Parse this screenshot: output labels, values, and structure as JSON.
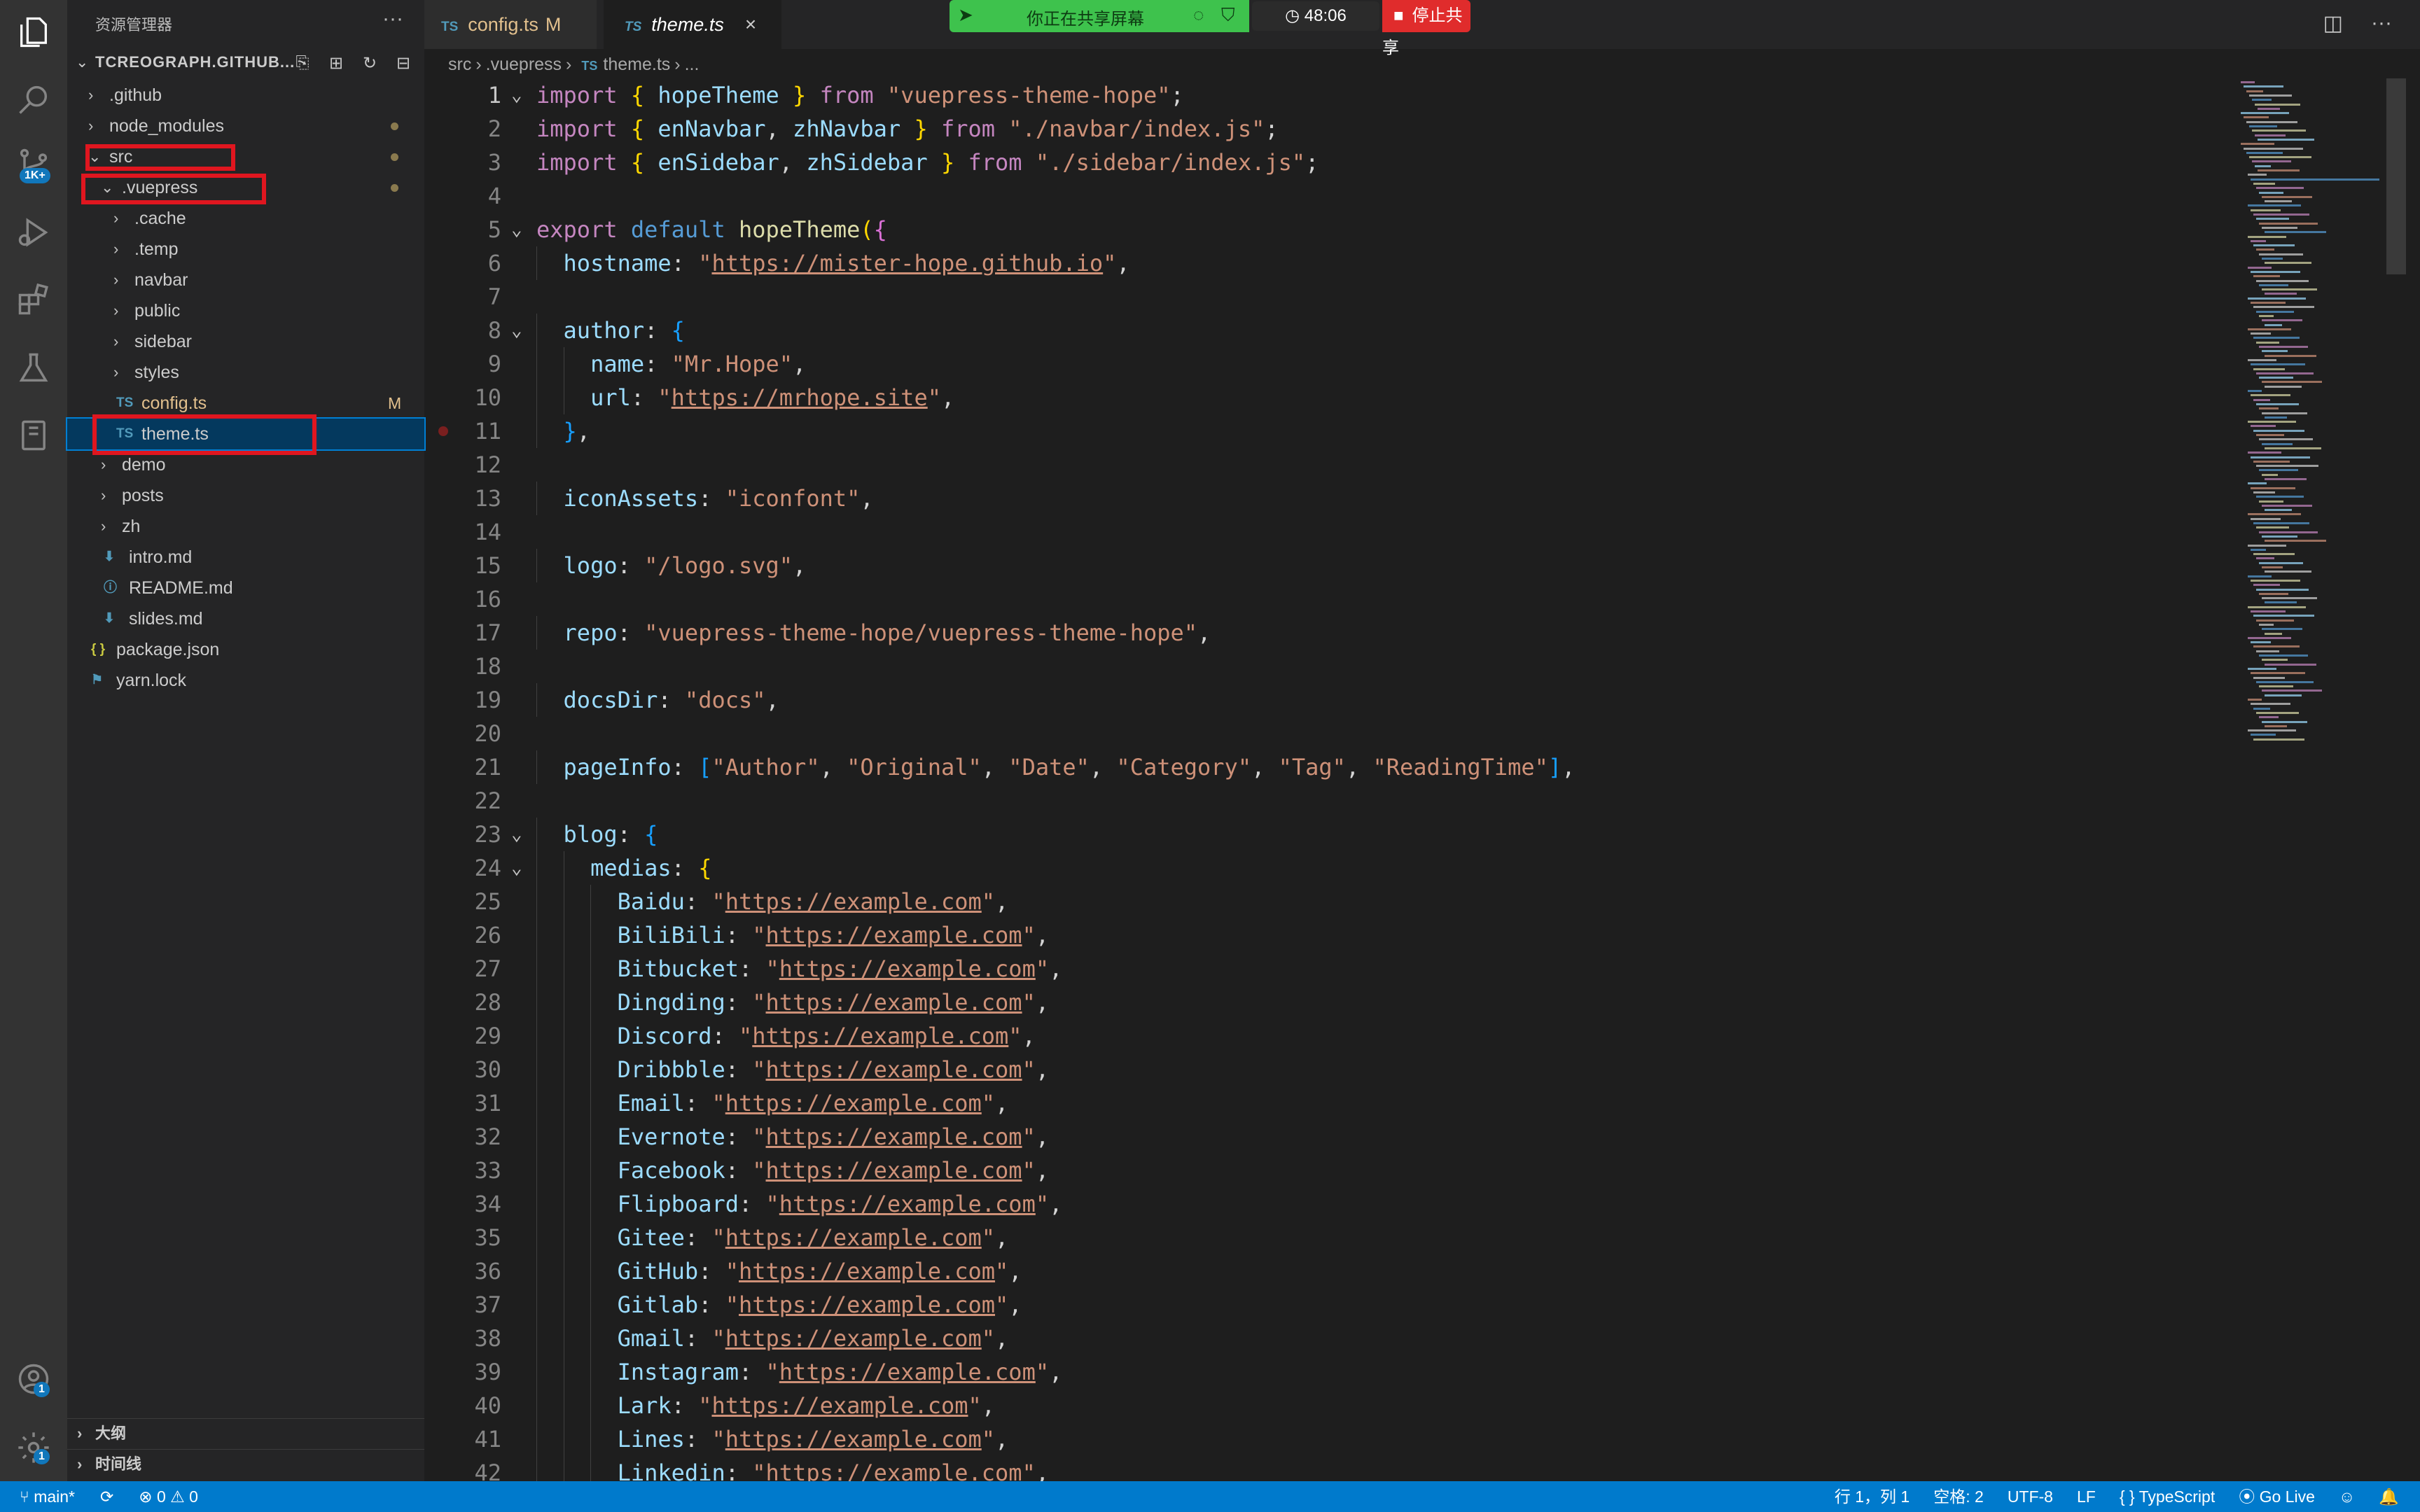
{
  "activity": {
    "scm_badge": "1K+",
    "accounts_badge": "1",
    "settings_badge": "1"
  },
  "explorer": {
    "title": "资源管理器",
    "more": "···",
    "workspace": "TCREOGRAPH.GITHUB...",
    "items": [
      {
        "label": ".github",
        "level": 0,
        "type": "folder",
        "open": false
      },
      {
        "label": "node_modules",
        "level": 0,
        "type": "folder",
        "open": false,
        "dot": true
      },
      {
        "label": "src",
        "level": 0,
        "type": "folder",
        "open": true,
        "dot": true
      },
      {
        "label": ".vuepress",
        "level": 1,
        "type": "folder",
        "open": true,
        "dot": true
      },
      {
        "label": ".cache",
        "level": 2,
        "type": "folder",
        "open": false
      },
      {
        "label": ".temp",
        "level": 2,
        "type": "folder",
        "open": false
      },
      {
        "label": "navbar",
        "level": 2,
        "type": "folder",
        "open": false
      },
      {
        "label": "public",
        "level": 2,
        "type": "folder",
        "open": false
      },
      {
        "label": "sidebar",
        "level": 2,
        "type": "folder",
        "open": false
      },
      {
        "label": "styles",
        "level": 2,
        "type": "folder",
        "open": false
      },
      {
        "label": "config.ts",
        "level": 2,
        "type": "ts",
        "modified": "M"
      },
      {
        "label": "theme.ts",
        "level": 2,
        "type": "ts",
        "selected": true
      },
      {
        "label": "demo",
        "level": 1,
        "type": "folder",
        "open": false
      },
      {
        "label": "posts",
        "level": 1,
        "type": "folder",
        "open": false
      },
      {
        "label": "zh",
        "level": 1,
        "type": "folder",
        "open": false
      },
      {
        "label": "intro.md",
        "level": 1,
        "type": "md"
      },
      {
        "label": "README.md",
        "level": 1,
        "type": "info"
      },
      {
        "label": "slides.md",
        "level": 1,
        "type": "md"
      },
      {
        "label": "package.json",
        "level": 0,
        "type": "json"
      },
      {
        "label": "yarn.lock",
        "level": 0,
        "type": "yarn"
      }
    ],
    "outline": "大纲",
    "timeline": "时间线"
  },
  "tabs": [
    {
      "label": "config.ts",
      "lang": "TS",
      "modified": "M"
    },
    {
      "label": "theme.ts",
      "lang": "TS",
      "close": "×"
    }
  ],
  "share": {
    "message": "你正在共享屏幕",
    "timer": "48:06",
    "stop": "停止共享"
  },
  "breadcrumb": {
    "parts": [
      "src",
      ".vuepress"
    ],
    "lang": "TS",
    "file": "theme.ts",
    "tail": "..."
  },
  "status": {
    "branch": "main*",
    "errors": "0",
    "warnings": "0",
    "position": "行 1，列 1",
    "spaces": "空格: 2",
    "encoding": "UTF-8",
    "eol": "LF",
    "language": "TypeScript",
    "golive": "Go Live"
  },
  "code": {
    "lines": [
      [
        [
          "kw",
          "import"
        ],
        [
          "pn",
          " "
        ],
        [
          "p1",
          "{"
        ],
        [
          "var",
          " hopeTheme "
        ],
        [
          "p1",
          "}"
        ],
        [
          "kw",
          " from "
        ],
        [
          "str",
          "\"vuepress-theme-hope\""
        ],
        [
          "pn",
          ";"
        ]
      ],
      [
        [
          "kw",
          "import"
        ],
        [
          "pn",
          " "
        ],
        [
          "p1",
          "{"
        ],
        [
          "var",
          " enNavbar"
        ],
        [
          "pn",
          ","
        ],
        [
          "var",
          " zhNavbar "
        ],
        [
          "p1",
          "}"
        ],
        [
          "kw",
          " from "
        ],
        [
          "str",
          "\"./navbar/index.js\""
        ],
        [
          "pn",
          ";"
        ]
      ],
      [
        [
          "kw",
          "import"
        ],
        [
          "pn",
          " "
        ],
        [
          "p1",
          "{"
        ],
        [
          "var",
          " enSidebar"
        ],
        [
          "pn",
          ","
        ],
        [
          "var",
          " zhSidebar "
        ],
        [
          "p1",
          "}"
        ],
        [
          "kw",
          " from "
        ],
        [
          "str",
          "\"./sidebar/index.js\""
        ],
        [
          "pn",
          ";"
        ]
      ],
      [],
      [
        [
          "kw",
          "export"
        ],
        [
          "kw2",
          " default "
        ],
        [
          "fn",
          "hopeTheme"
        ],
        [
          "p1",
          "("
        ],
        [
          "p2",
          "{"
        ]
      ],
      [
        [
          "pn",
          "  "
        ],
        [
          "var",
          "hostname"
        ],
        [
          "pn",
          ": "
        ],
        [
          "str",
          "\""
        ],
        [
          "url",
          "https://mister-hope.github.io"
        ],
        [
          "str",
          "\""
        ],
        [
          "pn",
          ","
        ]
      ],
      [],
      [
        [
          "pn",
          "  "
        ],
        [
          "var",
          "author"
        ],
        [
          "pn",
          ": "
        ],
        [
          "p3",
          "{"
        ]
      ],
      [
        [
          "pn",
          "    "
        ],
        [
          "var",
          "name"
        ],
        [
          "pn",
          ": "
        ],
        [
          "str",
          "\"Mr.Hope\""
        ],
        [
          "pn",
          ","
        ]
      ],
      [
        [
          "pn",
          "    "
        ],
        [
          "var",
          "url"
        ],
        [
          "pn",
          ": "
        ],
        [
          "str",
          "\""
        ],
        [
          "url",
          "https://mrhope.site"
        ],
        [
          "str",
          "\""
        ],
        [
          "pn",
          ","
        ]
      ],
      [
        [
          "pn",
          "  "
        ],
        [
          "p3",
          "}"
        ],
        [
          "pn",
          ","
        ]
      ],
      [],
      [
        [
          "pn",
          "  "
        ],
        [
          "var",
          "iconAssets"
        ],
        [
          "pn",
          ": "
        ],
        [
          "str",
          "\"iconfont\""
        ],
        [
          "pn",
          ","
        ]
      ],
      [],
      [
        [
          "pn",
          "  "
        ],
        [
          "var",
          "logo"
        ],
        [
          "pn",
          ": "
        ],
        [
          "str",
          "\"/logo.svg\""
        ],
        [
          "pn",
          ","
        ]
      ],
      [],
      [
        [
          "pn",
          "  "
        ],
        [
          "var",
          "repo"
        ],
        [
          "pn",
          ": "
        ],
        [
          "str",
          "\"vuepress-theme-hope/vuepress-theme-hope\""
        ],
        [
          "pn",
          ","
        ]
      ],
      [],
      [
        [
          "pn",
          "  "
        ],
        [
          "var",
          "docsDir"
        ],
        [
          "pn",
          ": "
        ],
        [
          "str",
          "\"docs\""
        ],
        [
          "pn",
          ","
        ]
      ],
      [],
      [
        [
          "pn",
          "  "
        ],
        [
          "var",
          "pageInfo"
        ],
        [
          "pn",
          ": "
        ],
        [
          "p3",
          "["
        ],
        [
          "str",
          "\"Author\""
        ],
        [
          "pn",
          ", "
        ],
        [
          "str",
          "\"Original\""
        ],
        [
          "pn",
          ", "
        ],
        [
          "str",
          "\"Date\""
        ],
        [
          "pn",
          ", "
        ],
        [
          "str",
          "\"Category\""
        ],
        [
          "pn",
          ", "
        ],
        [
          "str",
          "\"Tag\""
        ],
        [
          "pn",
          ", "
        ],
        [
          "str",
          "\"ReadingTime\""
        ],
        [
          "p3",
          "]"
        ],
        [
          "pn",
          ","
        ]
      ],
      [],
      [
        [
          "pn",
          "  "
        ],
        [
          "var",
          "blog"
        ],
        [
          "pn",
          ": "
        ],
        [
          "p3",
          "{"
        ]
      ],
      [
        [
          "pn",
          "    "
        ],
        [
          "var",
          "medias"
        ],
        [
          "pn",
          ": "
        ],
        [
          "p1",
          "{"
        ]
      ],
      [
        [
          "pn",
          "      "
        ],
        [
          "var",
          "Baidu"
        ],
        [
          "pn",
          ": "
        ],
        [
          "str",
          "\""
        ],
        [
          "url",
          "https://example.com"
        ],
        [
          "str",
          "\""
        ],
        [
          "pn",
          ","
        ]
      ],
      [
        [
          "pn",
          "      "
        ],
        [
          "var",
          "BiliBili"
        ],
        [
          "pn",
          ": "
        ],
        [
          "str",
          "\""
        ],
        [
          "url",
          "https://example.com"
        ],
        [
          "str",
          "\""
        ],
        [
          "pn",
          ","
        ]
      ],
      [
        [
          "pn",
          "      "
        ],
        [
          "var",
          "Bitbucket"
        ],
        [
          "pn",
          ": "
        ],
        [
          "str",
          "\""
        ],
        [
          "url",
          "https://example.com"
        ],
        [
          "str",
          "\""
        ],
        [
          "pn",
          ","
        ]
      ],
      [
        [
          "pn",
          "      "
        ],
        [
          "var",
          "Dingding"
        ],
        [
          "pn",
          ": "
        ],
        [
          "str",
          "\""
        ],
        [
          "url",
          "https://example.com"
        ],
        [
          "str",
          "\""
        ],
        [
          "pn",
          ","
        ]
      ],
      [
        [
          "pn",
          "      "
        ],
        [
          "var",
          "Discord"
        ],
        [
          "pn",
          ": "
        ],
        [
          "str",
          "\""
        ],
        [
          "url",
          "https://example.com"
        ],
        [
          "str",
          "\""
        ],
        [
          "pn",
          ","
        ]
      ],
      [
        [
          "pn",
          "      "
        ],
        [
          "var",
          "Dribbble"
        ],
        [
          "pn",
          ": "
        ],
        [
          "str",
          "\""
        ],
        [
          "url",
          "https://example.com"
        ],
        [
          "str",
          "\""
        ],
        [
          "pn",
          ","
        ]
      ],
      [
        [
          "pn",
          "      "
        ],
        [
          "var",
          "Email"
        ],
        [
          "pn",
          ": "
        ],
        [
          "str",
          "\""
        ],
        [
          "url",
          "https://example.com"
        ],
        [
          "str",
          "\""
        ],
        [
          "pn",
          ","
        ]
      ],
      [
        [
          "pn",
          "      "
        ],
        [
          "var",
          "Evernote"
        ],
        [
          "pn",
          ": "
        ],
        [
          "str",
          "\""
        ],
        [
          "url",
          "https://example.com"
        ],
        [
          "str",
          "\""
        ],
        [
          "pn",
          ","
        ]
      ],
      [
        [
          "pn",
          "      "
        ],
        [
          "var",
          "Facebook"
        ],
        [
          "pn",
          ": "
        ],
        [
          "str",
          "\""
        ],
        [
          "url",
          "https://example.com"
        ],
        [
          "str",
          "\""
        ],
        [
          "pn",
          ","
        ]
      ],
      [
        [
          "pn",
          "      "
        ],
        [
          "var",
          "Flipboard"
        ],
        [
          "pn",
          ": "
        ],
        [
          "str",
          "\""
        ],
        [
          "url",
          "https://example.com"
        ],
        [
          "str",
          "\""
        ],
        [
          "pn",
          ","
        ]
      ],
      [
        [
          "pn",
          "      "
        ],
        [
          "var",
          "Gitee"
        ],
        [
          "pn",
          ": "
        ],
        [
          "str",
          "\""
        ],
        [
          "url",
          "https://example.com"
        ],
        [
          "str",
          "\""
        ],
        [
          "pn",
          ","
        ]
      ],
      [
        [
          "pn",
          "      "
        ],
        [
          "var",
          "GitHub"
        ],
        [
          "pn",
          ": "
        ],
        [
          "str",
          "\""
        ],
        [
          "url",
          "https://example.com"
        ],
        [
          "str",
          "\""
        ],
        [
          "pn",
          ","
        ]
      ],
      [
        [
          "pn",
          "      "
        ],
        [
          "var",
          "Gitlab"
        ],
        [
          "pn",
          ": "
        ],
        [
          "str",
          "\""
        ],
        [
          "url",
          "https://example.com"
        ],
        [
          "str",
          "\""
        ],
        [
          "pn",
          ","
        ]
      ],
      [
        [
          "pn",
          "      "
        ],
        [
          "var",
          "Gmail"
        ],
        [
          "pn",
          ": "
        ],
        [
          "str",
          "\""
        ],
        [
          "url",
          "https://example.com"
        ],
        [
          "str",
          "\""
        ],
        [
          "pn",
          ","
        ]
      ],
      [
        [
          "pn",
          "      "
        ],
        [
          "var",
          "Instagram"
        ],
        [
          "pn",
          ": "
        ],
        [
          "str",
          "\""
        ],
        [
          "url",
          "https://example.com"
        ],
        [
          "str",
          "\""
        ],
        [
          "pn",
          ","
        ]
      ],
      [
        [
          "pn",
          "      "
        ],
        [
          "var",
          "Lark"
        ],
        [
          "pn",
          ": "
        ],
        [
          "str",
          "\""
        ],
        [
          "url",
          "https://example.com"
        ],
        [
          "str",
          "\""
        ],
        [
          "pn",
          ","
        ]
      ],
      [
        [
          "pn",
          "      "
        ],
        [
          "var",
          "Lines"
        ],
        [
          "pn",
          ": "
        ],
        [
          "str",
          "\""
        ],
        [
          "url",
          "https://example.com"
        ],
        [
          "str",
          "\""
        ],
        [
          "pn",
          ","
        ]
      ],
      [
        [
          "pn",
          "      "
        ],
        [
          "var",
          "Linkedin"
        ],
        [
          "pn",
          ": "
        ],
        [
          "str",
          "\""
        ],
        [
          "url",
          "https://example.com"
        ],
        [
          "str",
          "\""
        ],
        [
          "pn",
          ","
        ]
      ]
    ],
    "fold_lines": [
      1,
      5,
      8,
      23,
      24
    ],
    "breakpoint_line": 11
  }
}
